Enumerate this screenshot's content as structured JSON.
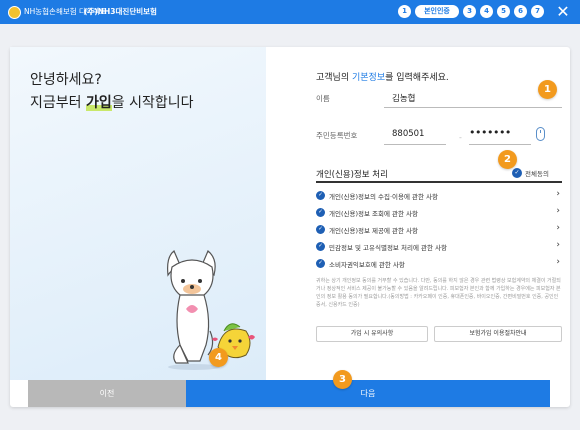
{
  "app": {
    "brand": "NH농협손해보험 다이렉트",
    "company": "(주)NH3대진단비보험",
    "steps": [
      "1",
      "본인인증",
      "3",
      "4",
      "5",
      "6",
      "7"
    ],
    "close_symbol": "✕"
  },
  "intro": {
    "line1": "안녕하세요?",
    "line2_prefix": "지금부터 ",
    "line2_highlight": "가입",
    "line2_suffix": "을 시작합니다"
  },
  "form": {
    "title_prefix": "고객님의 ",
    "title_highlight": "기본정보",
    "title_suffix": "를 입력해주세요.",
    "name_label": "이름",
    "name_value": "김농협",
    "rrn_label": "주민등록번호",
    "rrn_front": "880501",
    "rrn_dash": "-",
    "rrn_back": "•••••••"
  },
  "consent": {
    "title": "개인(신용)정보 처리",
    "all_agree": "전체동의",
    "terms": [
      "개인(신용)정보의 수집·이용에 관한 사항",
      "개인(신용)정보 조회에 관한 사항",
      "개인(신용)정보 제공에 관한 사항",
      "민감정보 및 고유식별정보 처리에 관한 사항",
      "소비자권익보호에 관한 사항"
    ],
    "fineprint": "귀하는 상기 개인정보 동의를 거부할 수 있습니다. 다만, 동의를 하지 않은 경우 관련 법령상 보험계약의 체결이 거절되거나 정상적인 서비스 제공이 불가능할 수 있음을 알려드립니다. 피보험자 본인과 함께 가입하는 경우에는 피보험자 본인의 정보 활용 동의가 필요합니다.(동의방법 : 카카오페이 인증, 휴대폰인증, 바이오인증, 간편비밀번호 인증, 공인인증서, 신용카드 인증)",
    "btn_notice": "가입 시 유의사항",
    "btn_guide": "보험가입 이용절차안내"
  },
  "nav": {
    "prev": "이전",
    "next": "다음"
  },
  "badges": [
    "1",
    "2",
    "3",
    "4"
  ],
  "colors": {
    "primary": "#1e7be4",
    "badge": "#f29a1e",
    "highlight": "#c9e86a"
  }
}
